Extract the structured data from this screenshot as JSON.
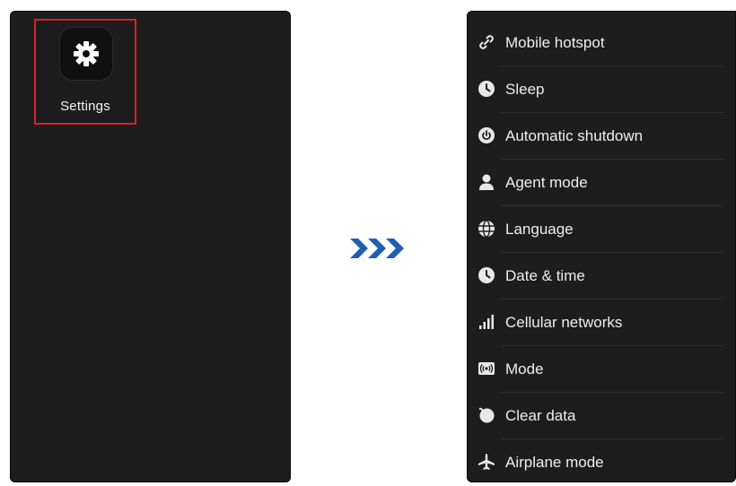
{
  "left_screen": {
    "app": {
      "label": "Settings",
      "icon": "gear-icon"
    }
  },
  "transition": {
    "icon": "triple-chevron-right-icon",
    "color": "#1f5fb0"
  },
  "right_screen": {
    "items": [
      {
        "label": "Mobile hotspot",
        "icon": "link-icon"
      },
      {
        "label": "Sleep",
        "icon": "clock-icon"
      },
      {
        "label": "Automatic shutdown",
        "icon": "power-icon"
      },
      {
        "label": "Agent mode",
        "icon": "person-icon"
      },
      {
        "label": "Language",
        "icon": "globe-icon"
      },
      {
        "label": "Date & time",
        "icon": "clock-icon"
      },
      {
        "label": "Cellular networks",
        "icon": "signal-bars-icon"
      },
      {
        "label": "Mode",
        "icon": "broadcast-icon"
      },
      {
        "label": "Clear data",
        "icon": "clear-icon"
      },
      {
        "label": "Airplane mode",
        "icon": "airplane-icon"
      }
    ]
  },
  "colors": {
    "screen_bg": "#1d1d1d",
    "highlight": "#d8232a",
    "text": "#eeeeee"
  }
}
